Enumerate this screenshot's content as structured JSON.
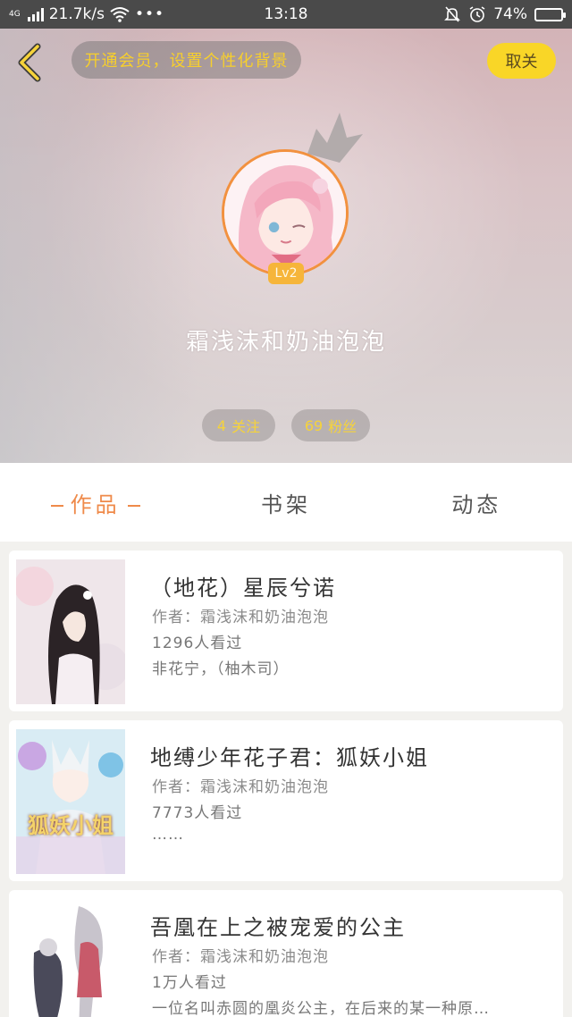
{
  "status_bar": {
    "network_type": "4G",
    "speed": "21.7k/s",
    "more": "•••",
    "time": "13:18",
    "battery": "74%",
    "battery_level": 0.74
  },
  "header": {
    "vip_banner": "开通会员，设置个性化背景",
    "unfollow_label": "取关",
    "level": "Lv2",
    "username": "霜浅沫和奶油泡泡",
    "following_count": "4",
    "following_label": "关注",
    "fans_count": "69",
    "fans_label": "粉丝"
  },
  "tabs": [
    {
      "label": "作品",
      "active": true
    },
    {
      "label": "书架",
      "active": false
    },
    {
      "label": "动态",
      "active": false
    }
  ],
  "books": [
    {
      "title": "（地花）星辰兮诺",
      "author": "作者：霜浅沫和奶油泡泡",
      "views": "1296人看过",
      "desc": "非花宁，（柚木司）"
    },
    {
      "title": "地缚少年花子君：狐妖小姐",
      "author": "作者：霜浅沫和奶油泡泡",
      "views": "7773人看过",
      "desc": "……",
      "cover_text": "狐妖小姐"
    },
    {
      "title": "吾凰在上之被宠爱的公主",
      "author": "作者：霜浅沫和奶油泡泡",
      "views": "1万人看过",
      "desc": "一位名叫赤圆的凰炎公主，在后来的某一种原…"
    }
  ],
  "colors": {
    "accent": "#ef8a4a",
    "vip_text": "#f7cf2c",
    "unfollow_bg": "#f9d627",
    "level_badge": "#f6b53a"
  },
  "icons": [
    "back-icon",
    "crown-icon",
    "wifi-icon",
    "mute-icon",
    "alarm-icon",
    "battery-icon",
    "signal-icon"
  ]
}
